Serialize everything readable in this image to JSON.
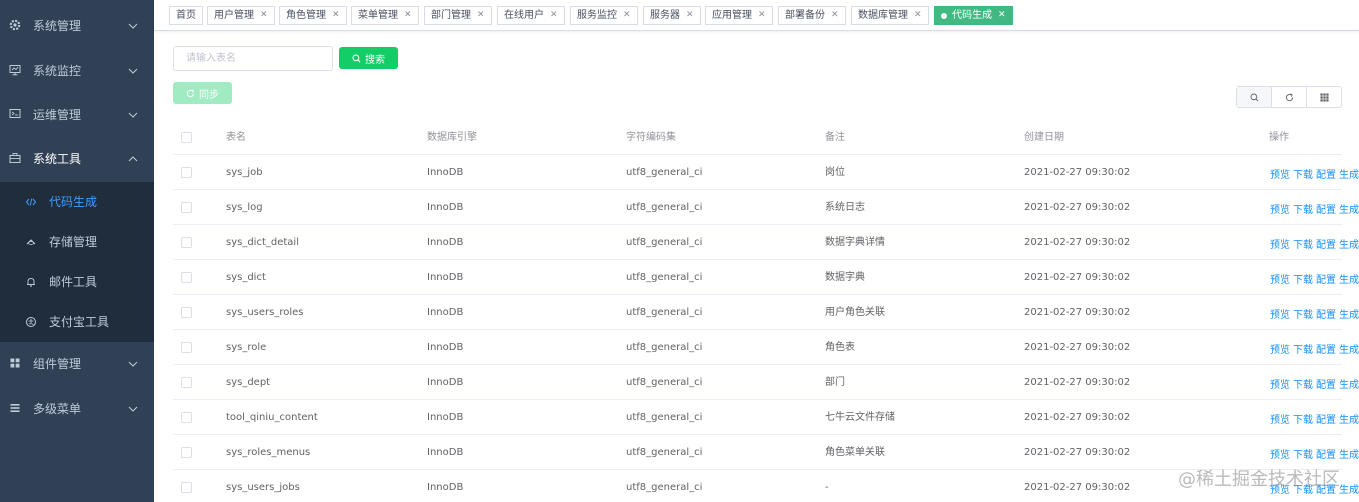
{
  "sidebar": {
    "items": [
      {
        "label": "系统管理",
        "icon": "gear-icon"
      },
      {
        "label": "系统监控",
        "icon": "monitor-icon"
      },
      {
        "label": "运维管理",
        "icon": "terminal-icon"
      },
      {
        "label": "系统工具",
        "icon": "toolbox-icon"
      },
      {
        "label": "组件管理",
        "icon": "grid-icon"
      },
      {
        "label": "多级菜单",
        "icon": "list-icon"
      }
    ],
    "subitems": [
      {
        "label": "代码生成",
        "icon": "code-icon"
      },
      {
        "label": "存储管理",
        "icon": "storage-icon"
      },
      {
        "label": "邮件工具",
        "icon": "bell-icon"
      },
      {
        "label": "支付宝工具",
        "icon": "alipay-icon"
      }
    ]
  },
  "tags": [
    {
      "label": "首页"
    },
    {
      "label": "用户管理"
    },
    {
      "label": "角色管理"
    },
    {
      "label": "菜单管理"
    },
    {
      "label": "部门管理"
    },
    {
      "label": "在线用户"
    },
    {
      "label": "服务监控"
    },
    {
      "label": "服务器"
    },
    {
      "label": "应用管理"
    },
    {
      "label": "部署备份"
    },
    {
      "label": "数据库管理"
    },
    {
      "label": "代码生成"
    }
  ],
  "toolbar": {
    "search_placeholder": "请输入表名",
    "search_label": "搜索",
    "sync_label": "同步"
  },
  "table": {
    "columns": [
      "表名",
      "数据库引擎",
      "字符编码集",
      "备注",
      "创建日期",
      "操作"
    ],
    "rows": [
      {
        "name": "sys_job",
        "engine": "InnoDB",
        "charset": "utf8_general_ci",
        "remark": "岗位",
        "date": "2021-02-27 09:30:02"
      },
      {
        "name": "sys_log",
        "engine": "InnoDB",
        "charset": "utf8_general_ci",
        "remark": "系统日志",
        "date": "2021-02-27 09:30:02"
      },
      {
        "name": "sys_dict_detail",
        "engine": "InnoDB",
        "charset": "utf8_general_ci",
        "remark": "数据字典详情",
        "date": "2021-02-27 09:30:02"
      },
      {
        "name": "sys_dict",
        "engine": "InnoDB",
        "charset": "utf8_general_ci",
        "remark": "数据字典",
        "date": "2021-02-27 09:30:02"
      },
      {
        "name": "sys_users_roles",
        "engine": "InnoDB",
        "charset": "utf8_general_ci",
        "remark": "用户角色关联",
        "date": "2021-02-27 09:30:02"
      },
      {
        "name": "sys_role",
        "engine": "InnoDB",
        "charset": "utf8_general_ci",
        "remark": "角色表",
        "date": "2021-02-27 09:30:02"
      },
      {
        "name": "sys_dept",
        "engine": "InnoDB",
        "charset": "utf8_general_ci",
        "remark": "部门",
        "date": "2021-02-27 09:30:02"
      },
      {
        "name": "tool_qiniu_content",
        "engine": "InnoDB",
        "charset": "utf8_general_ci",
        "remark": "七牛云文件存储",
        "date": "2021-02-27 09:30:02"
      },
      {
        "name": "sys_roles_menus",
        "engine": "InnoDB",
        "charset": "utf8_general_ci",
        "remark": "角色菜单关联",
        "date": "2021-02-27 09:30:02"
      },
      {
        "name": "sys_users_jobs",
        "engine": "InnoDB",
        "charset": "utf8_general_ci",
        "remark": "-",
        "date": "2021-02-27 09:30:02"
      }
    ],
    "actions": [
      "预览",
      "下载",
      "配置",
      "生成"
    ]
  },
  "watermark": "@稀土掘金技术社区",
  "colors": {
    "sidebar_bg": "#304156",
    "submenu_bg": "#1f2d3d",
    "active_menu": "#409eff",
    "active_tag": "#42b983",
    "search_button": "#13ce66",
    "link": "#1890ff"
  }
}
